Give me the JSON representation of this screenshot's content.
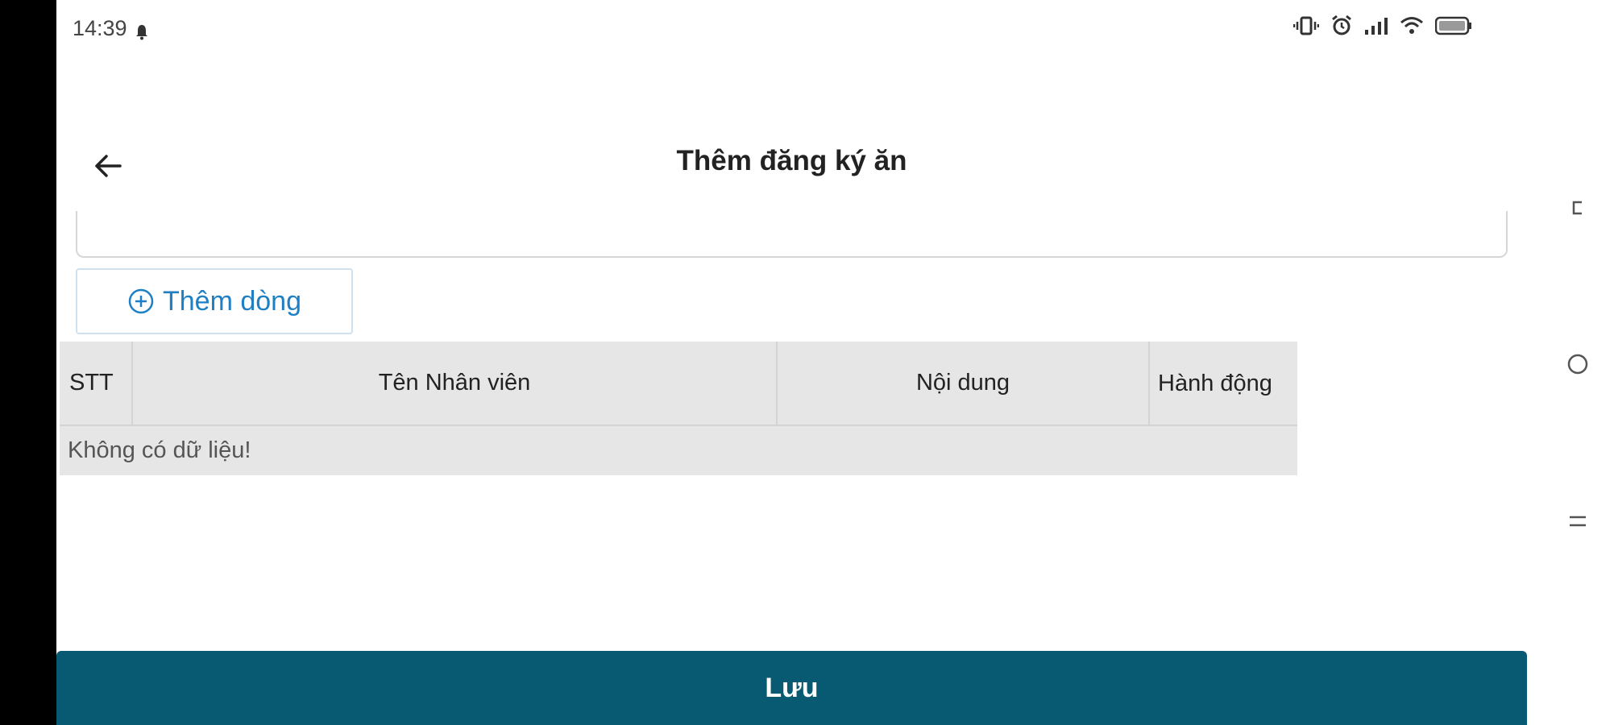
{
  "status_bar": {
    "time": "14:39"
  },
  "header": {
    "title": "Thêm đăng ký ăn"
  },
  "add_row_button": {
    "label": "Thêm dòng"
  },
  "table": {
    "columns": [
      "STT",
      "Tên Nhân viên",
      "Nội dung",
      "Hành động"
    ],
    "empty_message": "Không có dữ liệu!"
  },
  "save_button": {
    "label": "Lưu"
  },
  "colors": {
    "primary": "#075a72",
    "link_blue": "#1e7fc4",
    "table_header_bg": "#e6e6e6"
  },
  "icons": [
    "bell-icon",
    "vibrate-icon",
    "alarm-icon",
    "signal-icon",
    "wifi-icon",
    "battery-icon",
    "back-arrow-icon",
    "add-circle-icon",
    "recents-icon",
    "home-icon",
    "menu-icon"
  ]
}
